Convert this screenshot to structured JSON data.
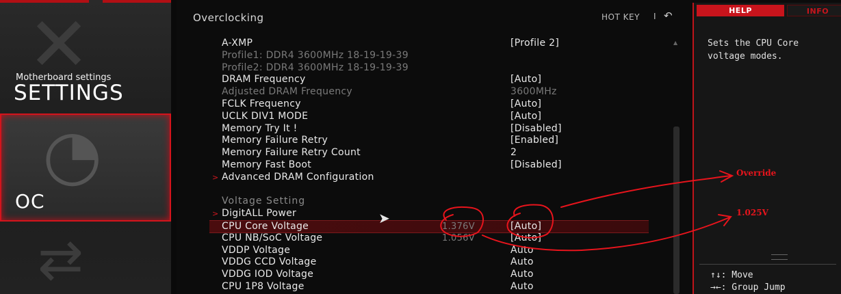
{
  "sidebar": {
    "settings_small": "Motherboard settings",
    "settings_big": "SETTINGS",
    "oc_label": "OC"
  },
  "header": {
    "title": "Overclocking",
    "hotkey": "HOT KEY",
    "separator": "I",
    "back_icon": "↶"
  },
  "rows": [
    {
      "label": "A-XMP",
      "value": "[Profile 2]"
    },
    {
      "label": "Profile1: DDR4 3600MHz 18-19-19-39",
      "value": "",
      "dim": true
    },
    {
      "label": "Profile2: DDR4 3600MHz 18-19-19-39",
      "value": "",
      "dim": true
    },
    {
      "label": "DRAM Frequency",
      "value": "[Auto]"
    },
    {
      "label": "Adjusted DRAM Frequency",
      "value": "3600MHz",
      "dim": true
    },
    {
      "label": "FCLK Frequency",
      "value": "[Auto]"
    },
    {
      "label": "UCLK DIV1 MODE",
      "value": "[Auto]"
    },
    {
      "label": "Memory Try It !",
      "value": "[Disabled]"
    },
    {
      "label": "Memory Failure Retry",
      "value": "[Enabled]"
    },
    {
      "label": "Memory Failure Retry Count",
      "value": "2"
    },
    {
      "label": "Memory Fast Boot",
      "value": "[Disabled]"
    },
    {
      "label": "Advanced DRAM Configuration",
      "value": "",
      "arrow": true
    },
    {
      "label": "",
      "value": ""
    },
    {
      "label": "Voltage  Setting",
      "value": "",
      "section": true
    },
    {
      "label": "DigitALL Power",
      "value": "",
      "arrow": true
    },
    {
      "label": "CPU Core Voltage",
      "current": "1.376V",
      "value": "[Auto]",
      "selected": true
    },
    {
      "label": "CPU NB/SoC Voltage",
      "current": "1.056V",
      "value": "[Auto]"
    },
    {
      "label": "VDDP Voltage",
      "value": "Auto"
    },
    {
      "label": "VDDG CCD Voltage",
      "value": "Auto"
    },
    {
      "label": "VDDG IOD Voltage",
      "value": "Auto"
    },
    {
      "label": "CPU 1P8 Voltage",
      "value": "Auto"
    }
  ],
  "help": {
    "tab_help": "HELP",
    "tab_info": "INFO",
    "text": "Sets the CPU Core\nvoltage modes.",
    "key_move": "↑↓: Move",
    "key_group": "→←: Group Jump"
  },
  "annotations": {
    "override": "Override",
    "voltage": "1.025V",
    "ink_color": "#e8141c"
  }
}
